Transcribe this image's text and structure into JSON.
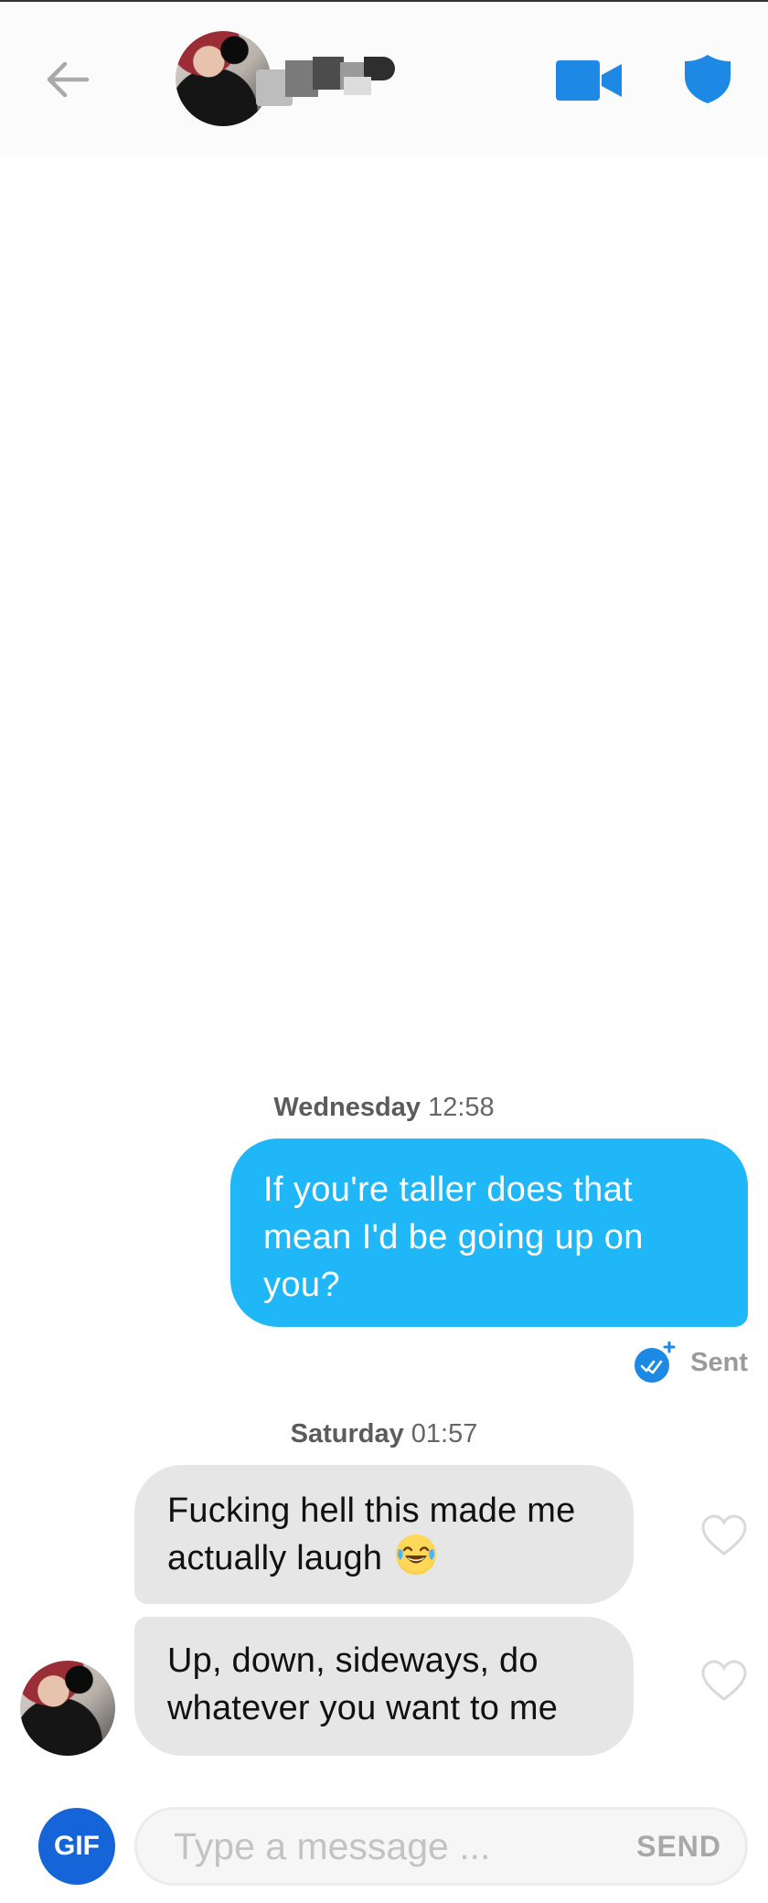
{
  "header": {
    "back_icon": "arrow-left-icon",
    "video_icon": "video-camera-icon",
    "safety_icon": "shield-icon",
    "accent_color": "#1e88e5"
  },
  "messages": [
    {
      "timestamp_day": "Wednesday",
      "timestamp_time": "12:58",
      "direction": "outgoing",
      "text": "If you're taller does that mean I'd be going up on you?",
      "status": "Sent",
      "bubble_color": "#1fb7f7"
    },
    {
      "timestamp_day": "Saturday",
      "timestamp_time": "01:57",
      "direction": "incoming",
      "text": "Fucking hell this made me actually laugh",
      "emoji": "😂"
    },
    {
      "direction": "incoming",
      "text": "Up, down, sideways, do whatever you want to me"
    }
  ],
  "composer": {
    "gif_label": "GIF",
    "placeholder": "Type a message ...",
    "send_label": "SEND"
  }
}
